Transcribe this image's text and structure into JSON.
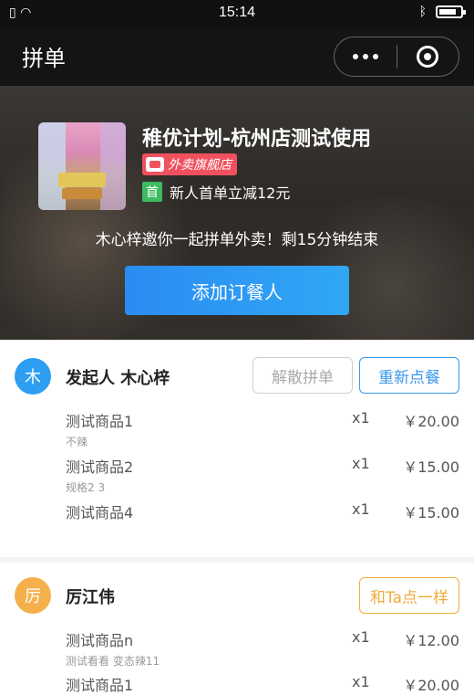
{
  "status_bar": {
    "time": "15:14",
    "left_icons": "sim-icon wifi-icon",
    "right_icons": "bluetooth-icon battery-icon"
  },
  "nav": {
    "title": "拼单"
  },
  "shop": {
    "name": "稚优计划-杭州店测试使用",
    "flag_badge": "外卖旗舰店",
    "promo_tag": "首",
    "promo_text": "新人首单立减12元",
    "invite_text": "木心梓邀你一起拼单外卖！剩15分钟结束",
    "add_button": "添加订餐人"
  },
  "orders": [
    {
      "avatar": "木",
      "name": "发起人 木心梓",
      "buttons": [
        "解散拼单",
        "重新点餐"
      ],
      "items": [
        {
          "name": "测试商品1",
          "spec": "不辣",
          "qty": "x1",
          "price": "￥20.00"
        },
        {
          "name": "测试商品2",
          "spec": "规格2 3",
          "qty": "x1",
          "price": "￥15.00"
        },
        {
          "name": "测试商品4",
          "spec": "",
          "qty": "x1",
          "price": "￥15.00"
        }
      ]
    },
    {
      "avatar": "厉",
      "name": "厉江伟",
      "buttons": [
        "和Ta点一样"
      ],
      "items": [
        {
          "name": "测试商品n",
          "spec": "测试看看 变态辣11",
          "qty": "x1",
          "price": "￥12.00"
        },
        {
          "name": "测试商品1",
          "spec": "",
          "qty": "x1",
          "price": "￥20.00"
        }
      ]
    }
  ],
  "colors": {
    "primary_blue": "#2e9ef2",
    "orange": "#f0ad3c",
    "green": "#3dbb5f",
    "red_badge": "#f1515f"
  }
}
